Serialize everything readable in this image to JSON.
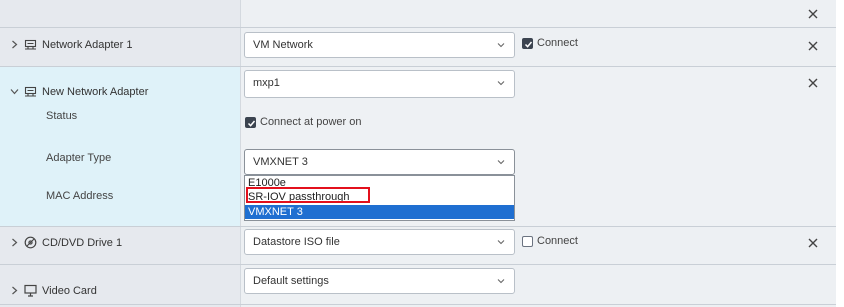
{
  "devices": {
    "network_adapter_1": {
      "label": "Network Adapter 1",
      "network_value": "VM Network",
      "connect_label": "Connect",
      "connect_checked": true
    },
    "new_network_adapter": {
      "label": "New Network Adapter",
      "network_value": "mxp1",
      "status_label": "Status",
      "status_checkbox_label": "Connect at power on",
      "adapter_type_label": "Adapter Type",
      "adapter_type_value": "VMXNET 3",
      "adapter_type_options": [
        "E1000e",
        "SR-IOV passthrough",
        "VMXNET 3"
      ],
      "mac_address_label": "MAC Address"
    },
    "cd_dvd_drive_1": {
      "label": "CD/DVD Drive 1",
      "value": "Datastore ISO file",
      "connect_label": "Connect",
      "connect_checked": false
    },
    "video_card": {
      "label": "Video Card",
      "value": "Default settings"
    }
  },
  "icons": {
    "expand": "chevron-right-icon",
    "collapse": "chevron-down-icon",
    "network": "network-adapter-icon",
    "cd": "cd-dvd-icon",
    "video": "monitor-icon",
    "remove": "close-icon"
  },
  "colors": {
    "selected_option": "#1f6fd1",
    "highlight_box": "#e3101c",
    "expanded_row": "#dff2f9"
  }
}
